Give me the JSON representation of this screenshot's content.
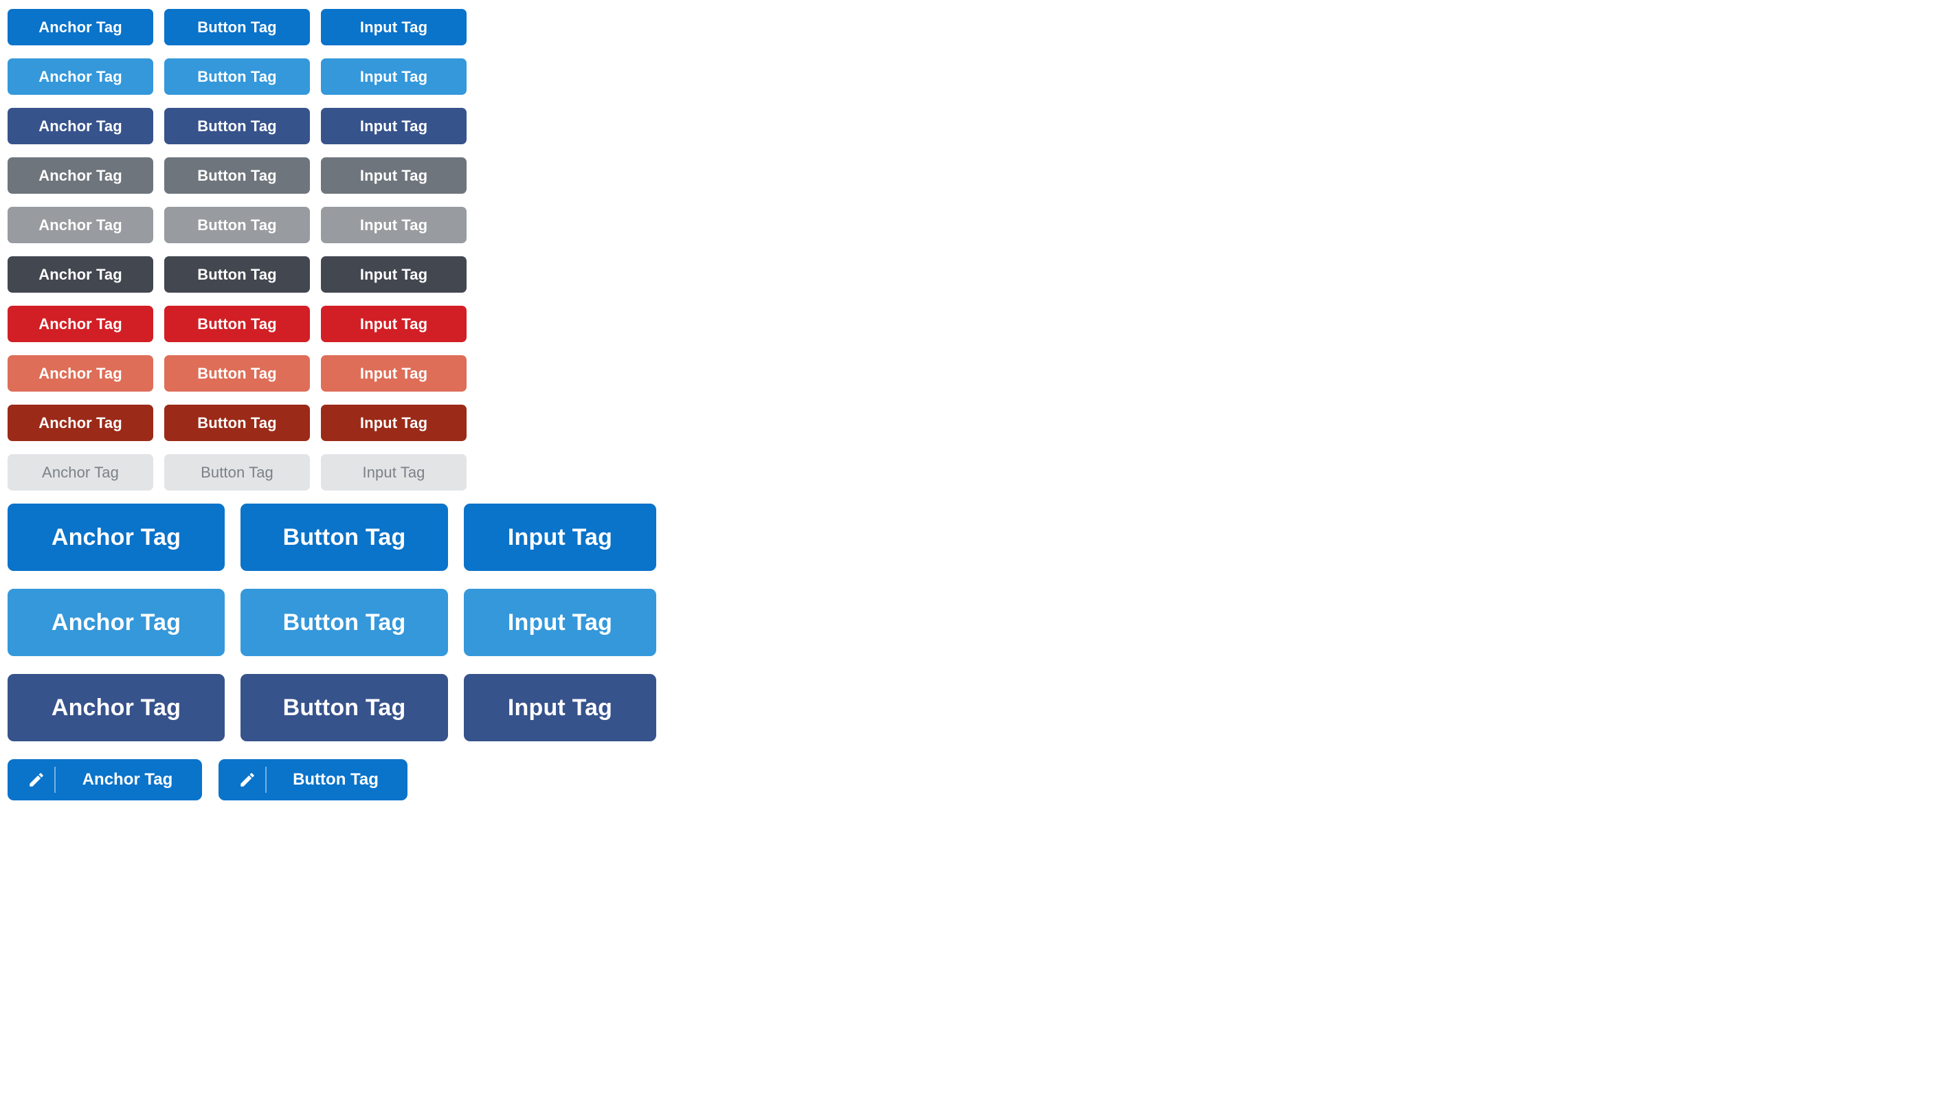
{
  "labels": {
    "anchor": "Anchor Tag",
    "button": "Button Tag",
    "input": "Input Tag"
  },
  "colors": {
    "primary": "#0a73ca",
    "primary_light": "#3498db",
    "primary_dark": "#37538c",
    "secondary": "#6f757c",
    "secondary_light": "#989b9f",
    "secondary_dark": "#434750",
    "danger": "#d21f25",
    "danger_light": "#de6e58",
    "danger_dark": "#9b2a18",
    "disabled_bg": "#e2e4e6",
    "disabled_text": "#7b8187",
    "label_text": "#ffffff",
    "page_background": "#ffffff"
  },
  "rows": [
    {
      "id": "primary",
      "size": "small",
      "variant": "v-primary",
      "disabled": false,
      "items": [
        {
          "kind": "anchor",
          "label": "Anchor Tag"
        },
        {
          "kind": "button",
          "label": "Button Tag"
        },
        {
          "kind": "input",
          "label": "Input Tag"
        }
      ]
    },
    {
      "id": "primary-light",
      "size": "small",
      "variant": "v-primary-light",
      "disabled": false,
      "items": [
        {
          "kind": "anchor",
          "label": "Anchor Tag"
        },
        {
          "kind": "button",
          "label": "Button Tag"
        },
        {
          "kind": "input",
          "label": "Input Tag"
        }
      ]
    },
    {
      "id": "primary-dark",
      "size": "small",
      "variant": "v-primary-dark",
      "disabled": false,
      "items": [
        {
          "kind": "anchor",
          "label": "Anchor Tag"
        },
        {
          "kind": "button",
          "label": "Button Tag"
        },
        {
          "kind": "input",
          "label": "Input Tag"
        }
      ]
    },
    {
      "id": "secondary",
      "size": "small",
      "variant": "v-secondary",
      "disabled": false,
      "items": [
        {
          "kind": "anchor",
          "label": "Anchor Tag"
        },
        {
          "kind": "button",
          "label": "Button Tag"
        },
        {
          "kind": "input",
          "label": "Input Tag"
        }
      ]
    },
    {
      "id": "secondary-light",
      "size": "small",
      "variant": "v-secondary-light",
      "disabled": false,
      "items": [
        {
          "kind": "anchor",
          "label": "Anchor Tag"
        },
        {
          "kind": "button",
          "label": "Button Tag"
        },
        {
          "kind": "input",
          "label": "Input Tag"
        }
      ]
    },
    {
      "id": "secondary-dark",
      "size": "small",
      "variant": "v-secondary-dark",
      "disabled": false,
      "items": [
        {
          "kind": "anchor",
          "label": "Anchor Tag"
        },
        {
          "kind": "button",
          "label": "Button Tag"
        },
        {
          "kind": "input",
          "label": "Input Tag"
        }
      ]
    },
    {
      "id": "danger",
      "size": "small",
      "variant": "v-danger",
      "disabled": false,
      "items": [
        {
          "kind": "anchor",
          "label": "Anchor Tag"
        },
        {
          "kind": "button",
          "label": "Button Tag"
        },
        {
          "kind": "input",
          "label": "Input Tag"
        }
      ]
    },
    {
      "id": "danger-light",
      "size": "small",
      "variant": "v-danger-light",
      "disabled": false,
      "items": [
        {
          "kind": "anchor",
          "label": "Anchor Tag"
        },
        {
          "kind": "button",
          "label": "Button Tag"
        },
        {
          "kind": "input",
          "label": "Input Tag"
        }
      ]
    },
    {
      "id": "danger-dark",
      "size": "small",
      "variant": "v-danger-dark",
      "disabled": false,
      "items": [
        {
          "kind": "anchor",
          "label": "Anchor Tag"
        },
        {
          "kind": "button",
          "label": "Button Tag"
        },
        {
          "kind": "input",
          "label": "Input Tag"
        }
      ]
    },
    {
      "id": "disabled",
      "size": "small",
      "variant": "v-disabled",
      "disabled": true,
      "items": [
        {
          "kind": "anchor",
          "label": "Anchor Tag"
        },
        {
          "kind": "button",
          "label": "Button Tag"
        },
        {
          "kind": "input",
          "label": "Input Tag"
        }
      ]
    },
    {
      "id": "large-primary",
      "size": "large",
      "variant": "v-primary",
      "disabled": false,
      "items": [
        {
          "kind": "anchor",
          "label": "Anchor Tag"
        },
        {
          "kind": "button",
          "label": "Button Tag"
        },
        {
          "kind": "input",
          "label": "Input Tag"
        }
      ]
    },
    {
      "id": "large-primary-light",
      "size": "large",
      "variant": "v-primary-light",
      "disabled": false,
      "items": [
        {
          "kind": "anchor",
          "label": "Anchor Tag"
        },
        {
          "kind": "button",
          "label": "Button Tag"
        },
        {
          "kind": "input",
          "label": "Input Tag"
        }
      ]
    },
    {
      "id": "large-primary-dark",
      "size": "large",
      "variant": "v-primary-dark",
      "disabled": false,
      "items": [
        {
          "kind": "anchor",
          "label": "Anchor Tag"
        },
        {
          "kind": "button",
          "label": "Button Tag"
        },
        {
          "kind": "input",
          "label": "Input Tag"
        }
      ]
    },
    {
      "id": "icon-primary",
      "size": "icon",
      "variant": "v-primary",
      "disabled": false,
      "icon": "pencil-edit-icon",
      "items": [
        {
          "kind": "anchor",
          "label": "Anchor Tag",
          "icon": "pencil-edit-icon"
        },
        {
          "kind": "button",
          "label": "Button Tag",
          "icon": "pencil-edit-icon"
        }
      ]
    }
  ]
}
